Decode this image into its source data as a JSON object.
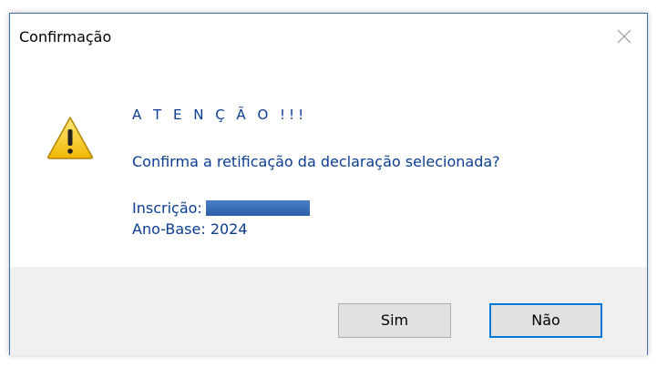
{
  "dialog": {
    "title": "Confirmação",
    "heading": "A T E N Ç Ã O !!!",
    "question": "Confirma a retificação da declaração selecionada?",
    "inscricao_label": "Inscrição:",
    "ano_base": "Ano-Base: 2024",
    "buttons": {
      "yes": "Sim",
      "no": "Não"
    }
  },
  "icons": {
    "close": "close-icon",
    "warning": "warning-icon"
  },
  "colors": {
    "text_accent": "#0a3d91",
    "dialog_border": "#3c6fb4",
    "footer_bg": "#f0f0f0",
    "button_focus": "#0078d7"
  }
}
